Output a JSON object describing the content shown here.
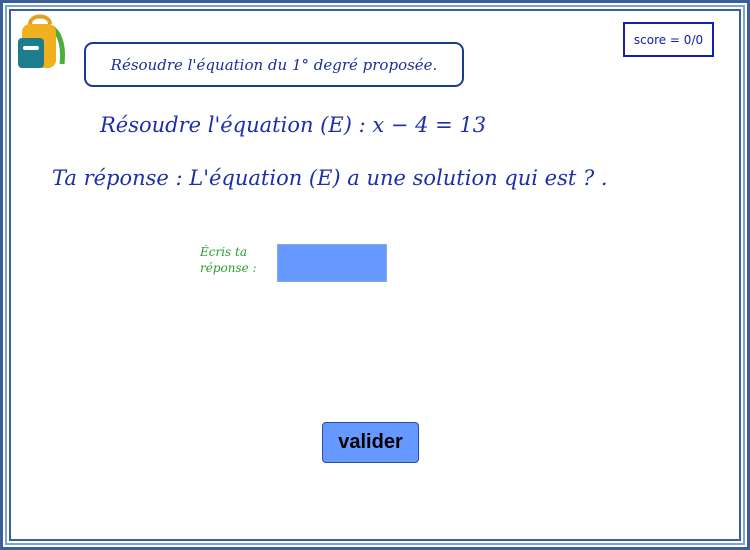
{
  "title": "Résoudre l'équation du 1° degré proposée.",
  "score": "score = 0/0",
  "equation": "Résoudre l'équation  (E) : x − 4 = 13",
  "answer_prompt": "Ta réponse :  L'équation (E) a une solution qui est ? .",
  "input_label": "Écris ta réponse :",
  "input": {
    "value": ""
  },
  "validate_label": "valider",
  "colors": {
    "frame_dark": "#3a5f99",
    "frame_light": "#7ea2d6",
    "text_blue": "#1c2fa8",
    "label_green": "#2aa02a",
    "input_bg": "#6699ff",
    "button_bg": "#6699ff"
  },
  "icons": {
    "logo": "backpack-icon"
  }
}
